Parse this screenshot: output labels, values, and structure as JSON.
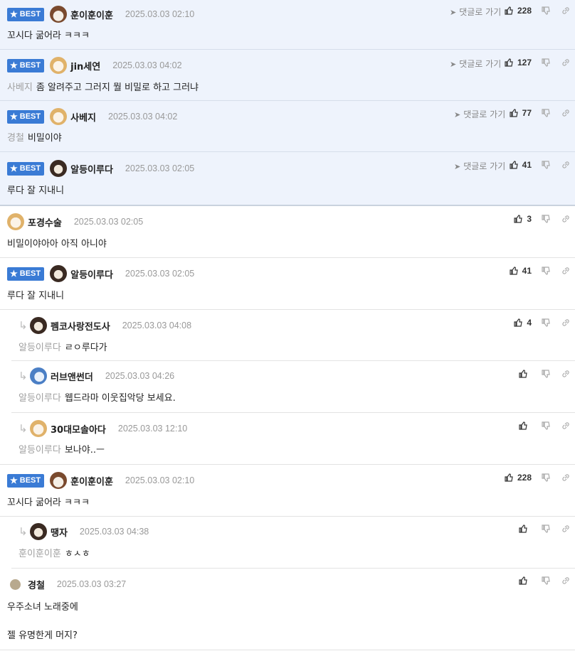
{
  "labels": {
    "best": "BEST",
    "goto": "댓글로 가기"
  },
  "colors": {
    "best_badge": "#3a7bd5",
    "best_bg": "#eef3fc"
  },
  "best_comments": [
    {
      "nick": "훈이훈이훈",
      "date": "2025.03.03 02:10",
      "likes": "228",
      "avatar": "dog-avatar",
      "mention": "",
      "text": "꼬시다 굶어라 ㅋㅋㅋ"
    },
    {
      "nick": "jin세연",
      "date": "2025.03.03 04:02",
      "likes": "127",
      "avatar": "fox-avatar",
      "mention": "사베지",
      "text": "좀 알려주고 그러지 뭘 비밀로 하고 그러냐"
    },
    {
      "nick": "사베지",
      "date": "2025.03.03 04:02",
      "likes": "77",
      "avatar": "fox-avatar",
      "mention": "경철",
      "text": "비밀이야"
    },
    {
      "nick": "알등이루다",
      "date": "2025.03.03 02:05",
      "likes": "41",
      "avatar": "dark-dog-avatar",
      "mention": "",
      "text": "루다 잘 지내니"
    }
  ],
  "comments": [
    {
      "nick": "포경수술",
      "date": "2025.03.03 02:05",
      "likes": "3",
      "mention": "",
      "text": "비밀이야아아 아직 아니야"
    },
    {
      "nick": "알등이루다",
      "date": "2025.03.03 02:05",
      "likes": "41",
      "mention": "",
      "text": "루다 잘 지내니"
    },
    {
      "nick": "펨코사랑전도사",
      "date": "2025.03.03 04:08",
      "likes": "4",
      "mention": "알등이루다",
      "text": "ㄹㅇ루다가"
    },
    {
      "nick": "러브앤썬더",
      "date": "2025.03.03 04:26",
      "likes": "",
      "mention": "알등이루다",
      "text": "웹드라마 이웃집악당 보세요."
    },
    {
      "nick": "30대모솔아다",
      "date": "2025.03.03 12:10",
      "likes": "",
      "mention": "알등이루다",
      "text": "보나야..ㅡ"
    },
    {
      "nick": "훈이훈이훈",
      "date": "2025.03.03 02:10",
      "likes": "228",
      "mention": "",
      "text": "꼬시다 굶어라 ㅋㅋㅋ"
    },
    {
      "nick": "땡자",
      "date": "2025.03.03 04:38",
      "likes": "",
      "mention": "훈이훈이훈",
      "text": "ㅎㅅㅎ"
    },
    {
      "nick": "경철",
      "date": "2025.03.03 03:27",
      "likes": "",
      "mention": "",
      "text": "우주소녀 노래중에",
      "text2": "젤 유명한게 머지?"
    }
  ]
}
